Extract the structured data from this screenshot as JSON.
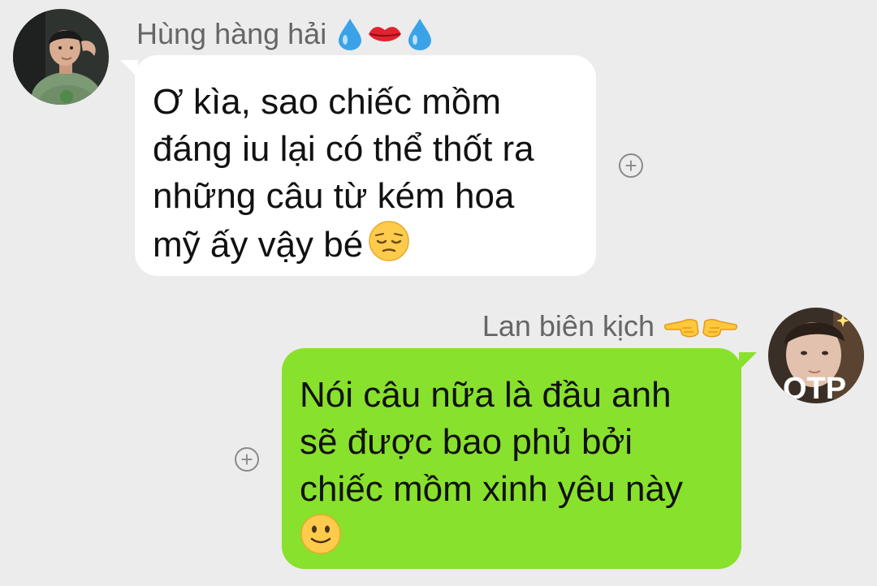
{
  "messages": [
    {
      "sender": "Hùng hàng hải",
      "sender_emojis": [
        "droplet-emoji",
        "lips-emoji",
        "droplet-emoji"
      ],
      "lines": [
        "Ơ kìa, sao chiếc mồm",
        "đáng iu lại có thể thốt ra",
        "những câu từ kém hoa",
        "mỹ ấy vậy bé"
      ],
      "trailing_emoji": "pensive-face-emoji",
      "bubble_color": "#ffffff",
      "reaction_button": "+"
    },
    {
      "sender": "Lan biên kịch",
      "sender_emojis": [
        "backhand-index-pointing-left-emoji",
        "backhand-index-pointing-right-emoji"
      ],
      "lines": [
        "Nói câu nữa là đầu anh",
        "sẽ được bao phủ bởi",
        "chiếc mồm xinh yêu này"
      ],
      "trailing_emoji": "slightly-smiling-face-emoji",
      "bubble_color": "#88e12c",
      "avatar_overlay_text": "OTP",
      "reaction_button": "+"
    }
  ],
  "colors": {
    "background": "#ececec",
    "sent_bubble": "#88e12c",
    "received_bubble": "#ffffff",
    "sender_name": "#666666"
  }
}
